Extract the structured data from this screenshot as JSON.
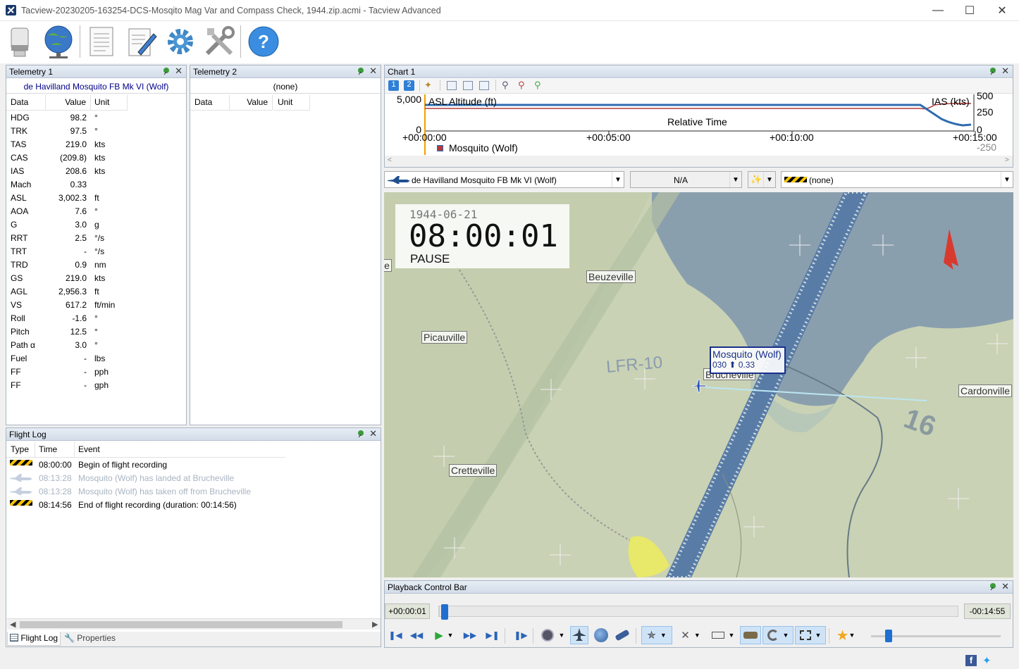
{
  "window": {
    "title": "Tacview-20230205-163254-DCS-Mosqito Mag Var and Compass Check, 1944.zip.acmi - Tacview Advanced",
    "minimize_icon": "minimize-icon",
    "maximize_icon": "maximize-icon",
    "close_icon": "close-icon"
  },
  "toolbar": {
    "icons": [
      "usb-drive-icon",
      "globe-network-icon",
      "document-icon",
      "edit-notes-icon",
      "gear-icon",
      "tools-icon",
      "help-icon"
    ]
  },
  "telemetry1": {
    "title": "Telemetry 1",
    "object": "de Havilland Mosquito FB Mk VI (Wolf)",
    "headers": {
      "data": "Data",
      "value": "Value",
      "unit": "Unit"
    },
    "rows": [
      {
        "label": "HDG",
        "value": "98.2",
        "unit": "°"
      },
      {
        "label": "TRK",
        "value": "97.5",
        "unit": "°"
      },
      {
        "label": "TAS",
        "value": "219.0",
        "unit": "kts"
      },
      {
        "label": "CAS",
        "value": "(209.8)",
        "unit": "kts"
      },
      {
        "label": "IAS",
        "value": "208.6",
        "unit": "kts"
      },
      {
        "label": "Mach",
        "value": "0.33",
        "unit": ""
      },
      {
        "label": "ASL",
        "value": "3,002.3",
        "unit": "ft"
      },
      {
        "label": "AOA",
        "value": "7.6",
        "unit": "°"
      },
      {
        "label": "G",
        "value": "3.0",
        "unit": "g"
      },
      {
        "label": "RRT",
        "value": "2.5",
        "unit": "°/s"
      },
      {
        "label": "TRT",
        "value": "-",
        "unit": "°/s"
      },
      {
        "label": "TRD",
        "value": "0.9",
        "unit": "nm"
      },
      {
        "label": "GS",
        "value": "219.0",
        "unit": "kts"
      },
      {
        "label": "AGL",
        "value": "2,956.3",
        "unit": "ft"
      },
      {
        "label": "VS",
        "value": "617.2",
        "unit": "ft/min"
      },
      {
        "label": "Roll",
        "value": "-1.6",
        "unit": "°"
      },
      {
        "label": "Pitch",
        "value": "12.5",
        "unit": "°"
      },
      {
        "label": "Path α",
        "value": "3.0",
        "unit": "°"
      },
      {
        "label": "Fuel",
        "value": "-",
        "unit": "lbs"
      },
      {
        "label": "FF",
        "value": "-",
        "unit": "pph"
      },
      {
        "label": "FF",
        "value": "-",
        "unit": "gph"
      }
    ]
  },
  "telemetry2": {
    "title": "Telemetry 2",
    "object": "(none)",
    "headers": {
      "data": "Data",
      "value": "Value",
      "unit": "Unit"
    }
  },
  "flightlog": {
    "title": "Flight Log",
    "headers": {
      "type": "Type",
      "time": "Time",
      "event": "Event"
    },
    "rows": [
      {
        "icon": "hazard-stripe-icon",
        "time": "08:00:00",
        "event": "Begin of flight recording",
        "faded": false
      },
      {
        "icon": "aircraft-icon",
        "time": "08:13:28",
        "event": "Mosquito (Wolf) has landed at Brucheville",
        "faded": true
      },
      {
        "icon": "aircraft-icon",
        "time": "08:13:28",
        "event": "Mosquito (Wolf) has taken off from Brucheville",
        "faded": true
      },
      {
        "icon": "hazard-stripe-icon",
        "time": "08:14:56",
        "event": "End of flight recording (duration: 00:14:56)",
        "faded": false
      }
    ],
    "tabs": {
      "log": "Flight Log",
      "properties": "Properties"
    }
  },
  "chart": {
    "title": "Chart 1",
    "tab1": "1",
    "tab2": "2",
    "left_series": "ASL Altitude (ft)",
    "right_series": "IAS (kts)",
    "left_axis": {
      "top": "5,000",
      "bottom": "0"
    },
    "right_axis": {
      "t500": "500",
      "t250": "250",
      "t0": "0",
      "tneg": "-250"
    },
    "xlabel": "Relative Time",
    "xticks": [
      "+00:00:00",
      "+00:05:00",
      "+00:10:00",
      "+00:15:00"
    ],
    "legend": "Mosquito (Wolf)",
    "colors": {
      "altitude": "#2e6bb0",
      "ias": "#b03a3a",
      "cursor": "#f0a000"
    }
  },
  "selectors": {
    "object": "de Havilland Mosquito FB Mk VI (Wolf)",
    "target": "N/A",
    "secondary": "(none)"
  },
  "map": {
    "date": "1944-06-21",
    "time": "08:00:01",
    "state": "PAUSE",
    "labels": {
      "beuzeville": "Beuzeville",
      "picauville": "Picauville",
      "cretteville": "Cretteville",
      "cardonville": "Cardonville",
      "brucheville": "Brucheville",
      "edge": "le",
      "airfield": "LFR-10",
      "runway": "16"
    },
    "aircraft_label": "Mosquito (Wolf)",
    "aircraft_info": "030 ⬆ 0.33"
  },
  "playback": {
    "title": "Playback Control Bar",
    "elapsed": "+00:00:01",
    "remaining": "-00:14:55",
    "progress": 0.001
  }
}
